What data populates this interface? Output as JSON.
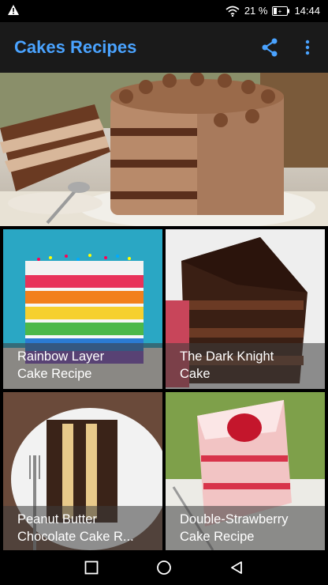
{
  "status": {
    "battery_percent": "21 %",
    "time": "14:44",
    "icons": [
      "warning-icon",
      "wifi-icon",
      "battery-icon"
    ]
  },
  "app": {
    "title": "Cakes Recipes",
    "accent": "#4aa3ff",
    "actions": [
      "share-icon",
      "overflow-menu-icon"
    ]
  },
  "hero": {
    "image": "chocolate-layer-cake-photo"
  },
  "recipes": [
    {
      "title": "Rainbow Layer\nCake Recipe",
      "image": "rainbow-cake-photo"
    },
    {
      "title": "The Dark Knight\nCake",
      "image": "dark-chocolate-cake-photo"
    },
    {
      "title": "Peanut Butter\nChocolate Cake R...",
      "image": "peanut-butter-cake-photo"
    },
    {
      "title": "Double-Strawberry\nCake Recipe",
      "image": "strawberry-cake-photo"
    }
  ],
  "nav": [
    "recents-icon",
    "home-icon",
    "back-icon"
  ]
}
